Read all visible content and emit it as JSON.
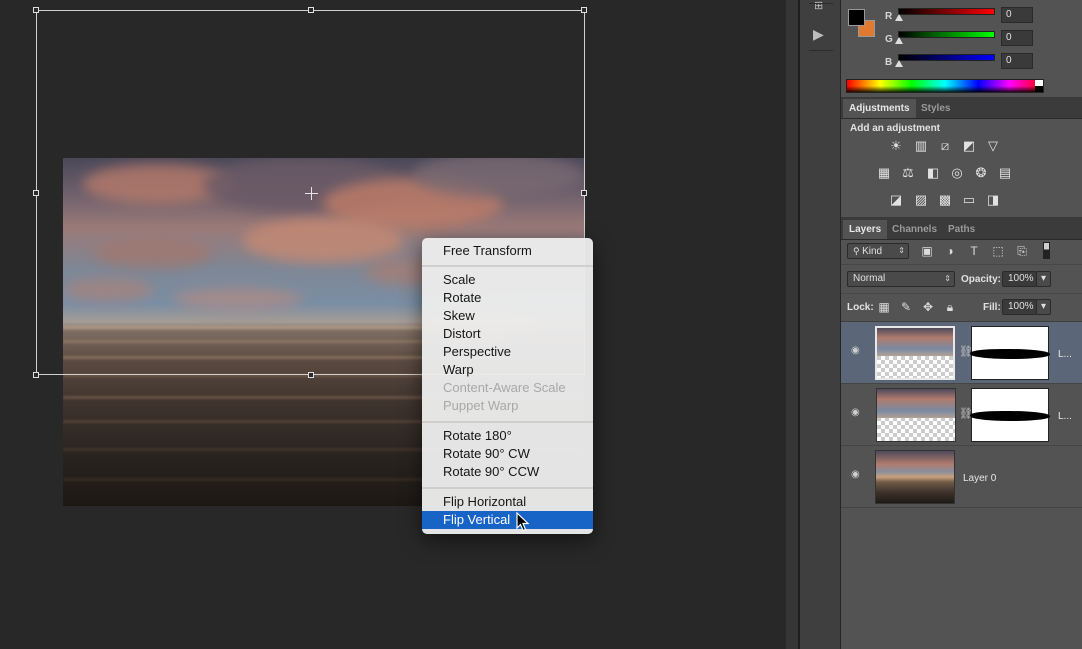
{
  "context_menu": {
    "items": [
      {
        "label": "Free Transform"
      },
      {
        "label": "Scale"
      },
      {
        "label": "Rotate"
      },
      {
        "label": "Skew"
      },
      {
        "label": "Distort"
      },
      {
        "label": "Perspective"
      },
      {
        "label": "Warp"
      },
      {
        "label": "Content-Aware Scale",
        "disabled": true
      },
      {
        "label": "Puppet Warp",
        "disabled": true
      },
      {
        "label": "Rotate 180°"
      },
      {
        "label": "Rotate 90° CW"
      },
      {
        "label": "Rotate 90° CCW"
      },
      {
        "label": "Flip Horizontal"
      },
      {
        "label": "Flip Vertical",
        "selected": true
      }
    ]
  },
  "color_panel": {
    "foreground": "#000000",
    "background": "#e07a30",
    "channels": [
      {
        "label": "R",
        "value": "0"
      },
      {
        "label": "G",
        "value": "0"
      },
      {
        "label": "B",
        "value": "0"
      }
    ]
  },
  "adjustments_panel": {
    "tabs": [
      "Adjustments",
      "Styles"
    ],
    "heading": "Add an adjustment",
    "icons": [
      "brightness-contrast-icon",
      "levels-icon",
      "curves-icon",
      "exposure-icon",
      "vibrance-icon",
      "hue-saturation-icon",
      "color-balance-icon",
      "black-white-icon",
      "photo-filter-icon",
      "channel-mixer-icon",
      "color-lookup-icon",
      "invert-icon",
      "posterize-icon",
      "threshold-icon",
      "gradient-map-icon"
    ]
  },
  "layers_panel": {
    "tabs": [
      "Layers",
      "Channels",
      "Paths"
    ],
    "filter_kind": "Kind",
    "blend_mode": "Normal",
    "opacity_label": "Opacity:",
    "opacity_value": "100%",
    "lock_label": "Lock:",
    "fill_label": "Fill:",
    "fill_value": "100%",
    "layers": [
      {
        "name": "L...",
        "has_mask": true,
        "selected": true
      },
      {
        "name": "L...",
        "has_mask": true,
        "selected": false
      },
      {
        "name": "Layer 0",
        "has_mask": false,
        "selected": false
      }
    ]
  },
  "colors": {
    "menu_highlight": "#1763c6",
    "panel_bg": "#535353",
    "canvas_bg": "#282828",
    "selected_layer": "#5b6778"
  }
}
